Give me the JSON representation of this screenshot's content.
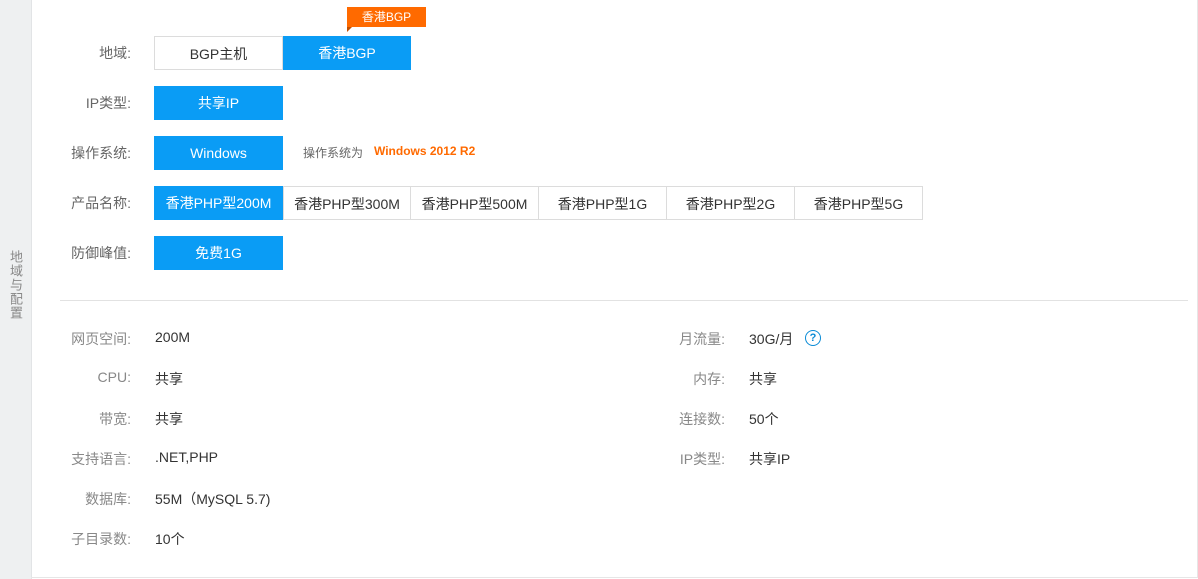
{
  "sidebar": {
    "tab_label": "地域与配置"
  },
  "region": {
    "label": "地域:",
    "badge": "香港BGP",
    "options": [
      "BGP主机",
      "香港BGP"
    ],
    "selected": "香港BGP"
  },
  "ip_type": {
    "label": "IP类型:",
    "options": [
      "共享IP"
    ]
  },
  "os": {
    "label": "操作系统:",
    "options": [
      "Windows"
    ],
    "note_label": "操作系统为",
    "note_value": "Windows 2012 R2"
  },
  "product": {
    "label": "产品名称:",
    "options": [
      "香港PHP型200M",
      "香港PHP型300M",
      "香港PHP型500M",
      "香港PHP型1G",
      "香港PHP型2G",
      "香港PHP型5G"
    ],
    "selected": "香港PHP型200M"
  },
  "defense": {
    "label": "防御峰值:",
    "options": [
      "免费1G"
    ]
  },
  "specs": {
    "left": [
      {
        "label": "网页空间:",
        "value": "200M"
      },
      {
        "label": "CPU:",
        "value": "共享"
      },
      {
        "label": "带宽:",
        "value": "共享"
      },
      {
        "label": "支持语言:",
        "value": ".NET,PHP"
      },
      {
        "label": "数据库:",
        "value": "55M（MySQL 5.7)"
      },
      {
        "label": "子目录数:",
        "value": "10个"
      }
    ],
    "right": [
      {
        "label": "月流量:",
        "value": "30G/月"
      },
      {
        "label": "内存:",
        "value": "共享"
      },
      {
        "label": "连接数:",
        "value": "50个"
      },
      {
        "label": "IP类型:",
        "value": "共享IP"
      }
    ],
    "help_icon": "question-circle-icon"
  },
  "colors": {
    "accent": "#0a9cf5",
    "badge": "#ff6a00",
    "note": "#ff6a00"
  }
}
